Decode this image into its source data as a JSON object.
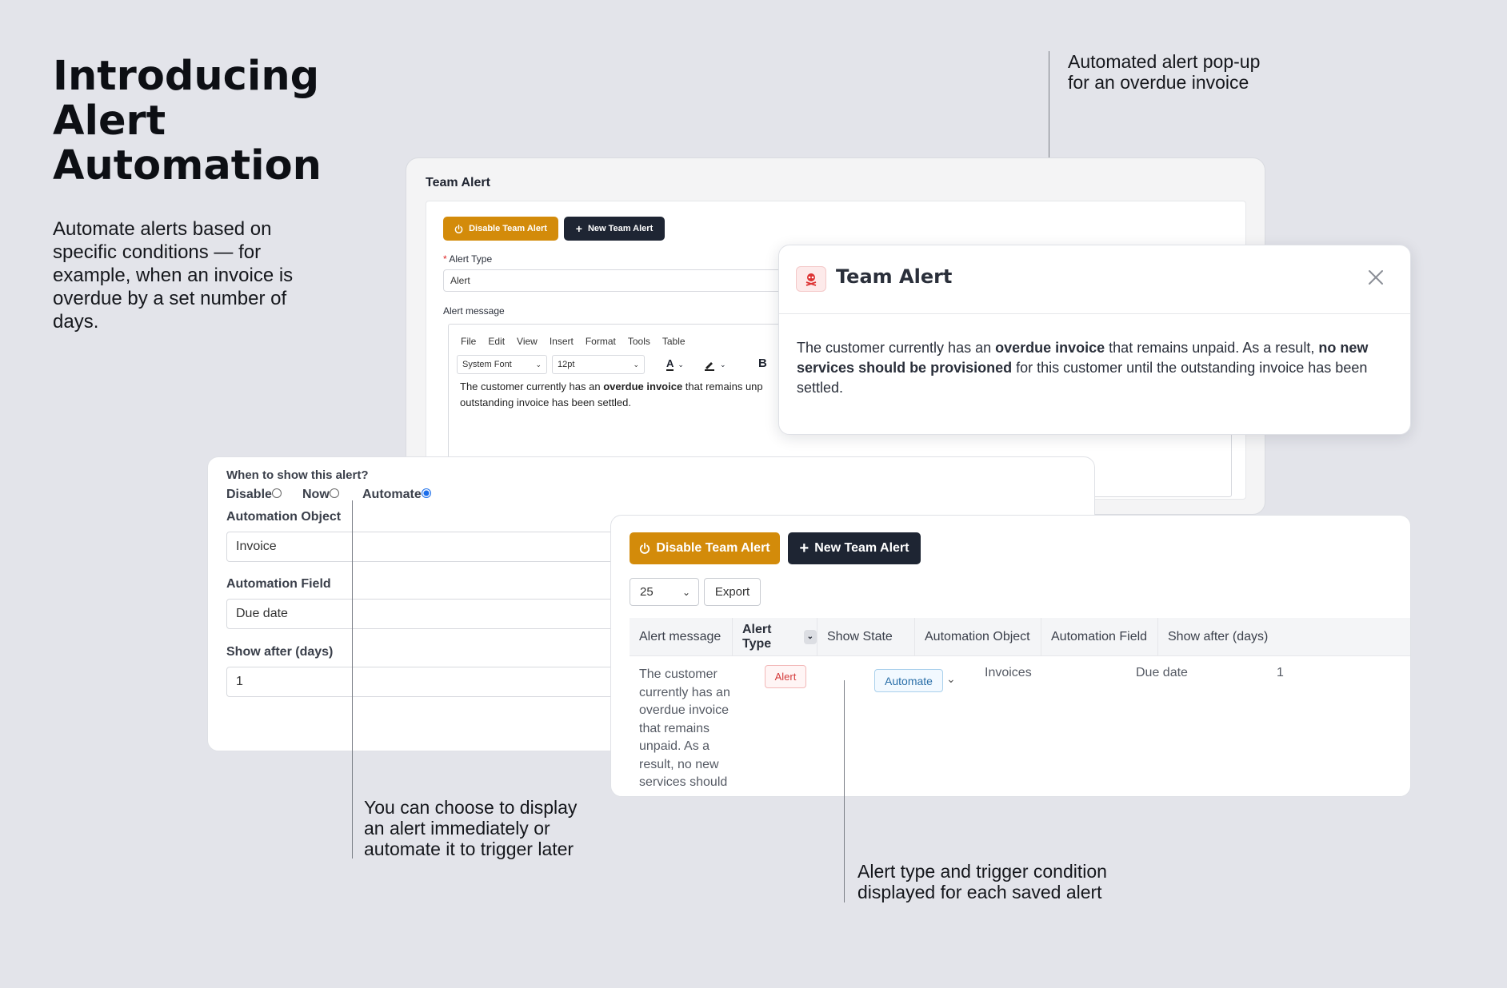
{
  "intro": {
    "title": "Introducing\nAlert\nAutomation",
    "description": "Automate alerts based on specific conditions — for example, when an invoice is overdue by a set number of days."
  },
  "annotations": {
    "popup_note": "Automated alert pop-up\nfor an overdue invoice",
    "choose_note": "You can choose to display\nan alert immediately or\nautomate it to trigger later",
    "type_note": "Alert type and trigger condition\ndisplayed for each saved alert"
  },
  "editor_card": {
    "title": "Team Alert",
    "disable_button": "Disable Team Alert",
    "new_button": "New Team Alert",
    "alert_type_label": "Alert Type",
    "alert_type_required": "*",
    "alert_type_value": "Alert",
    "alert_message_label": "Alert message",
    "menu": [
      "File",
      "Edit",
      "View",
      "Insert",
      "Format",
      "Tools",
      "Table"
    ],
    "font_select": "System Font",
    "size_select": "12pt",
    "bold_button": "B",
    "text_color_letter": "A",
    "message_part1": "The customer currently has an ",
    "message_bold1": "overdue invoice",
    "message_part2": " that remains unp",
    "message_line2": "outstanding invoice has been settled."
  },
  "popup": {
    "title": "Team Alert",
    "text1": "The customer currently has an ",
    "bold1": "overdue invoice",
    "text2": " that remains unpaid. As a result, ",
    "bold2": "no new services should be provisioned",
    "text3": " for this customer until the outstanding invoice has been settled."
  },
  "settings": {
    "question": "When to show this alert?",
    "options": [
      "Disable",
      "Now",
      "Automate"
    ],
    "selected": "Automate",
    "object_label": "Automation Object",
    "object_value": "Invoice",
    "field_label": "Automation Field",
    "field_value": "Due date",
    "days_label": "Show after (days)",
    "days_value": "1"
  },
  "table_card": {
    "disable_button": "Disable Team Alert",
    "new_button": "New Team Alert",
    "page_size": "25",
    "export_button": "Export",
    "columns": [
      "Alert message",
      "Alert Type",
      "Show State",
      "Automation Object",
      "Automation Field",
      "Show after (days)"
    ],
    "row": {
      "message_lines": [
        "The customer",
        "currently has an",
        "overdue invoice",
        "that remains",
        "unpaid. As a",
        "result, no new",
        "services should"
      ],
      "alert_type": "Alert",
      "show_state": "Automate",
      "automation_object": "Invoices",
      "automation_field": "Due date",
      "show_after": "1"
    }
  },
  "colors": {
    "background": "#e3e4ea",
    "amber_button": "#d38b0a",
    "dark_button": "#1e2533",
    "radio_selected": "#1a6dea",
    "alert_badge": "#d43a3a",
    "automate_badge": "#2a6fa8"
  }
}
